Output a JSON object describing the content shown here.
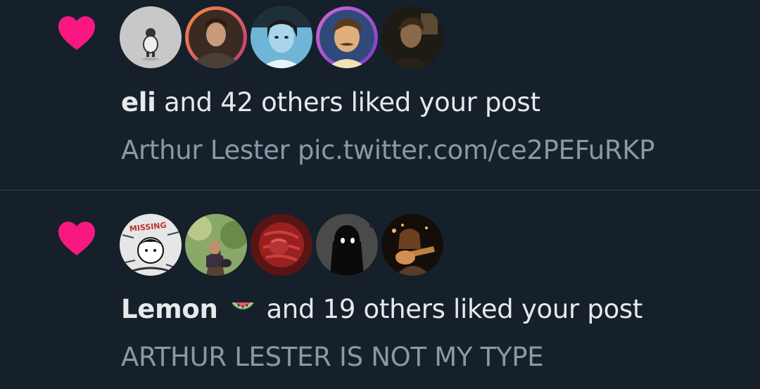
{
  "notifications": [
    {
      "type": "like",
      "actor_name": "eli",
      "actor_emoji": "",
      "rest_text": "and 42 others liked your post",
      "post_text": "Arthur Lester pic.twitter.com/ce2PEFuRKP",
      "avatars": [
        "avatar-1",
        "avatar-2",
        "avatar-3",
        "avatar-4",
        "avatar-5"
      ]
    },
    {
      "type": "like",
      "actor_name": "Lemon",
      "actor_emoji": "watermelon-icon",
      "rest_text": "and 19 others liked your post",
      "post_text": "ARTHUR LESTER IS NOT MY TYPE",
      "avatars": [
        "avatar-1",
        "avatar-2",
        "avatar-3",
        "avatar-4",
        "avatar-5"
      ],
      "avatar_1_text": "MISSING"
    }
  ],
  "colors": {
    "background": "#15202b",
    "heart": "#f91880",
    "primary_text": "#e7e9ea",
    "secondary_text": "#8b98a5",
    "divider": "#38444d"
  },
  "icons": {
    "like": "heart-icon",
    "emoji": "watermelon-icon"
  }
}
